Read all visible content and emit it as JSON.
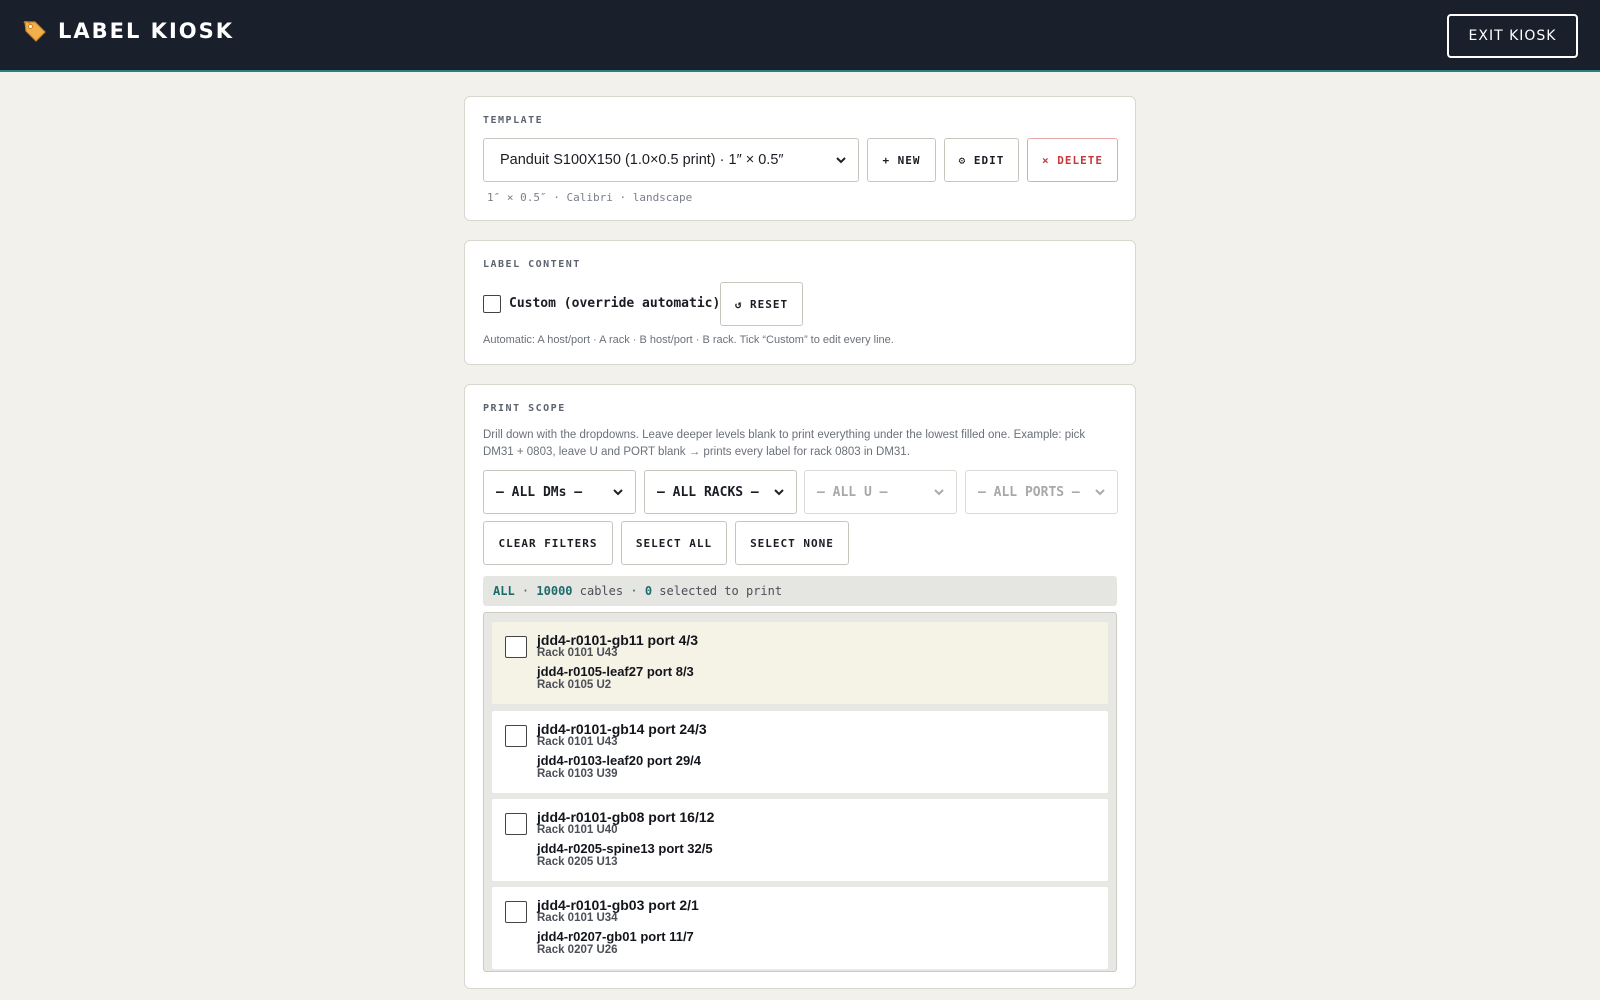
{
  "header": {
    "title": "LABEL KIOSK",
    "icon": "tag-icon",
    "exit_label": "EXIT KIOSK"
  },
  "template": {
    "section_title": "TEMPLATE",
    "selected": "Panduit S100X150 (1.0×0.5 print) · 1″ × 0.5″",
    "new_label": "+ NEW",
    "edit_label": "⚙ EDIT",
    "delete_label": "× DELETE",
    "meta": "1″ × 0.5″ · Calibri · landscape"
  },
  "label_content": {
    "section_title": "LABEL CONTENT",
    "custom_label": "Custom (override automatic)",
    "custom_checked": false,
    "reset_label": "↺ RESET",
    "hint": "Automatic: A host/port · A rack · B host/port · B rack. Tick “Custom” to edit every line."
  },
  "print_scope": {
    "section_title": "PRINT SCOPE",
    "description": "Drill down with the dropdowns. Leave deeper levels blank to print everything under the lowest filled one. Example: pick DM31 + 0803, leave U and PORT blank → prints every label for rack 0803 in DM31.",
    "filters": {
      "dm": "— ALL DMs —",
      "rack": "— ALL RACKS —",
      "u": "— ALL U —",
      "port": "— ALL PORTS —"
    },
    "clear_label": "CLEAR FILTERS",
    "select_all_label": "SELECT ALL",
    "select_none_label": "SELECT NONE",
    "status": {
      "scope": "ALL",
      "sep1": "·",
      "count": "10000",
      "count_suffix": "cables",
      "sep2": "·",
      "selected": "0",
      "selected_suffix": "selected to print"
    },
    "cables": [
      {
        "a_host": "jdd4-r0101-gb11 port 4/3",
        "a_rack": "Rack 0101 U43",
        "b_host": "jdd4-r0105-leaf27 port 8/3",
        "b_rack": "Rack 0105 U2"
      },
      {
        "a_host": "jdd4-r0101-gb14 port 24/3",
        "a_rack": "Rack 0101 U43",
        "b_host": "jdd4-r0103-leaf20 port 29/4",
        "b_rack": "Rack 0103 U39"
      },
      {
        "a_host": "jdd4-r0101-gb08 port 16/12",
        "a_rack": "Rack 0101 U40",
        "b_host": "jdd4-r0205-spine13 port 32/5",
        "b_rack": "Rack 0205 U13"
      },
      {
        "a_host": "jdd4-r0101-gb03 port 2/1",
        "a_rack": "Rack 0101 U34",
        "b_host": "jdd4-r0207-gb01 port 11/7",
        "b_rack": "Rack 0207 U26"
      }
    ]
  }
}
